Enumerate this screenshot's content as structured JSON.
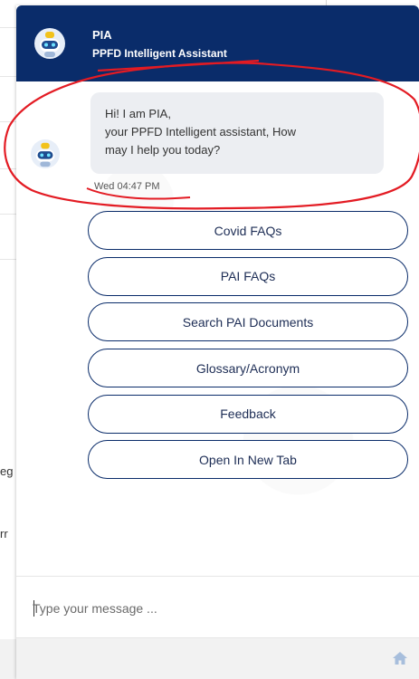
{
  "background": {
    "fragments": [
      "eg",
      "rr"
    ]
  },
  "header": {
    "title": "PIA",
    "subtitle": "PPFD Intelligent Assistant",
    "color": "#0a2c6a"
  },
  "conversation": {
    "message_lines": [
      "Hi! I am PIA,",
      "your PPFD Intelligent assistant, How",
      "may I help you today?"
    ],
    "timestamp": "Wed 04:47 PM"
  },
  "options": [
    {
      "label": "Covid FAQs"
    },
    {
      "label": "PAI FAQs"
    },
    {
      "label": "Search PAI Documents"
    },
    {
      "label": "Glossary/Acronym"
    },
    {
      "label": "Feedback"
    },
    {
      "label": "Open In New Tab"
    }
  ],
  "composer": {
    "placeholder": "Type your message ..."
  },
  "footer": {
    "icon": "home-icon"
  },
  "annotation": {
    "color": "#e31b23"
  }
}
